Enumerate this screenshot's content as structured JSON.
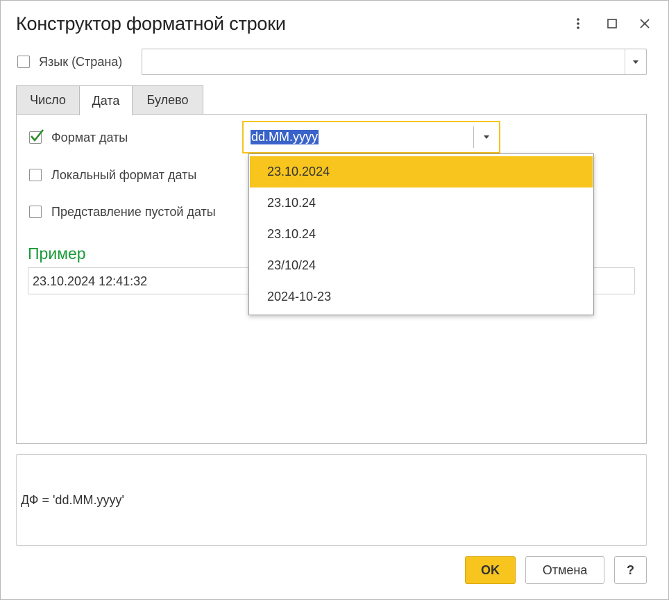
{
  "window": {
    "title": "Конструктор форматной строки"
  },
  "language": {
    "label": "Язык (Страна)",
    "value": ""
  },
  "tabs": [
    {
      "label": "Число"
    },
    {
      "label": "Дата"
    },
    {
      "label": "Булево"
    }
  ],
  "date_tab": {
    "format_label": "Формат даты",
    "format_value": "dd.MM.yyyy",
    "local_format_label": "Локальный формат даты",
    "empty_date_label": "Представление пустой даты",
    "example_title": "Пример",
    "example_value": "23.10.2024 12:41:32"
  },
  "dropdown": {
    "options": [
      "23.10.2024",
      "23.10.24",
      "23.10.24",
      "23/10/24",
      "2024-10-23"
    ]
  },
  "result": {
    "text": "ДФ = 'dd.MM.yyyy'"
  },
  "buttons": {
    "ok": "OK",
    "cancel": "Отмена",
    "help": "?"
  },
  "colors": {
    "accent": "#f7c51d",
    "check": "#2e8b2e",
    "section_title": "#1a9a3a",
    "selection": "#3a63c9"
  }
}
